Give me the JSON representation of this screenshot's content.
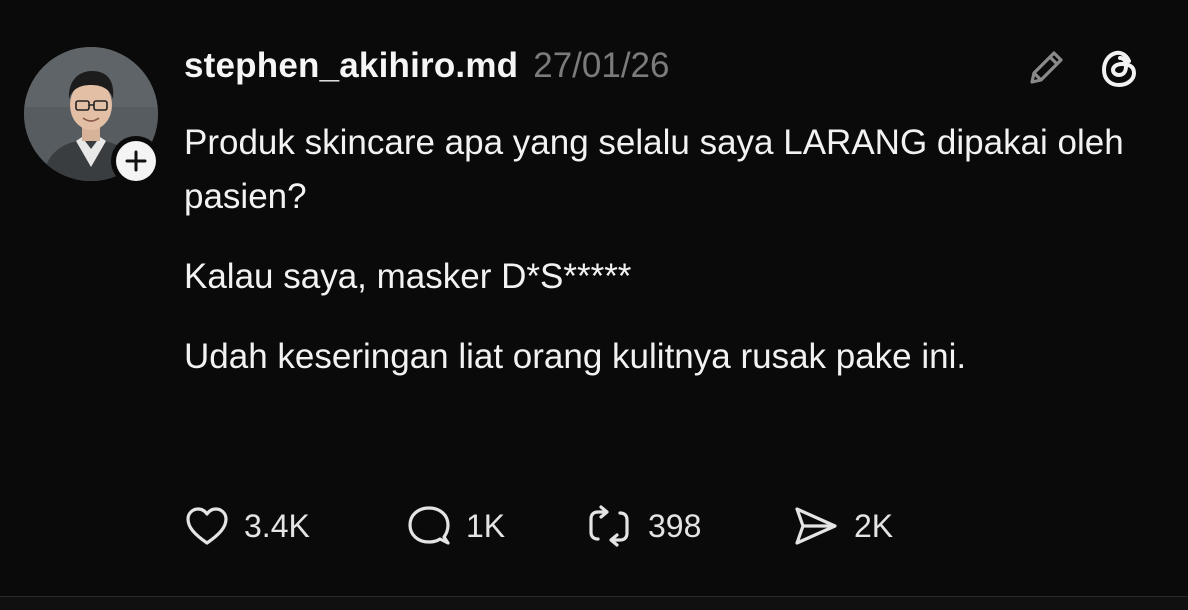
{
  "post": {
    "username": "stephen_akihiro.md",
    "timestamp": "27/01/26",
    "paragraphs": [
      "Produk skincare apa yang selalu saya LARANG dipakai oleh pasien?",
      "Kalau saya, masker D*S*****",
      "Udah keseringan liat orang kulitnya rusak pake ini."
    ],
    "actions": {
      "likes": "3.4K",
      "replies": "1K",
      "reposts": "398",
      "shares": "2K"
    }
  },
  "icons": {
    "follow": "plus-icon",
    "edit": "pencil-icon",
    "app": "threads-logo-icon",
    "like": "heart-icon",
    "reply": "speech-bubble-icon",
    "repost": "repost-icon",
    "share": "send-icon"
  },
  "colors": {
    "background": "#0a0a0a",
    "text": "#f2f2f2",
    "muted": "#7b7b7b"
  }
}
